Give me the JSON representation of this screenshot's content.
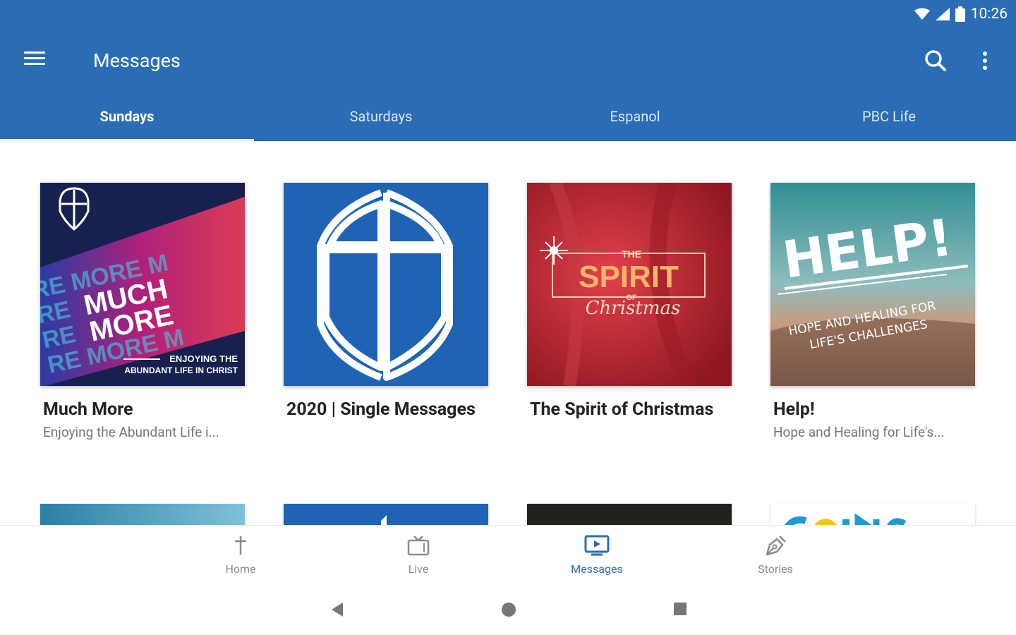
{
  "status_bar": {
    "time": "10:26"
  },
  "toolbar": {
    "title": "Messages",
    "menu_icon": "hamburger-menu-icon",
    "search_icon": "search-icon",
    "more_icon": "more-vert-icon"
  },
  "tabs": [
    {
      "label": "Sundays",
      "active": true
    },
    {
      "label": "Saturdays",
      "active": false
    },
    {
      "label": "Espanol",
      "active": false
    },
    {
      "label": "PBC Life",
      "active": false
    }
  ],
  "cards": [
    {
      "title": "Much More",
      "subtitle": "Enjoying the Abundant Life i...",
      "art": {
        "line1": "MUCH",
        "line2": "MORE",
        "tagline1": "ENJOYING THE",
        "tagline2": "ABUNDANT LIFE IN CHRIST"
      }
    },
    {
      "title": "2020 | Single Messages",
      "subtitle": ""
    },
    {
      "title": "The Spirit of Christmas",
      "subtitle": "",
      "art": {
        "the": "THE",
        "main": "SPIRIT",
        "of": "OF",
        "script": "Christmas"
      }
    },
    {
      "title": "Help!",
      "subtitle": "Hope and Healing for Life's...",
      "art": {
        "main": "HELP!",
        "tagline1": "HOPE AND HEALING FOR",
        "tagline2": "LIFE'S CHALLENGES"
      }
    }
  ],
  "bottom_nav": [
    {
      "label": "Home",
      "icon": "cross-icon",
      "active": false
    },
    {
      "label": "Live",
      "icon": "tv-icon",
      "active": false
    },
    {
      "label": "Messages",
      "icon": "play-screen-icon",
      "active": true
    },
    {
      "label": "Stories",
      "icon": "pen-nib-icon",
      "active": false
    }
  ],
  "colors": {
    "primary": "#2a6db5",
    "active_nav": "#2a6db5",
    "inactive_nav": "#8a8a8a"
  }
}
